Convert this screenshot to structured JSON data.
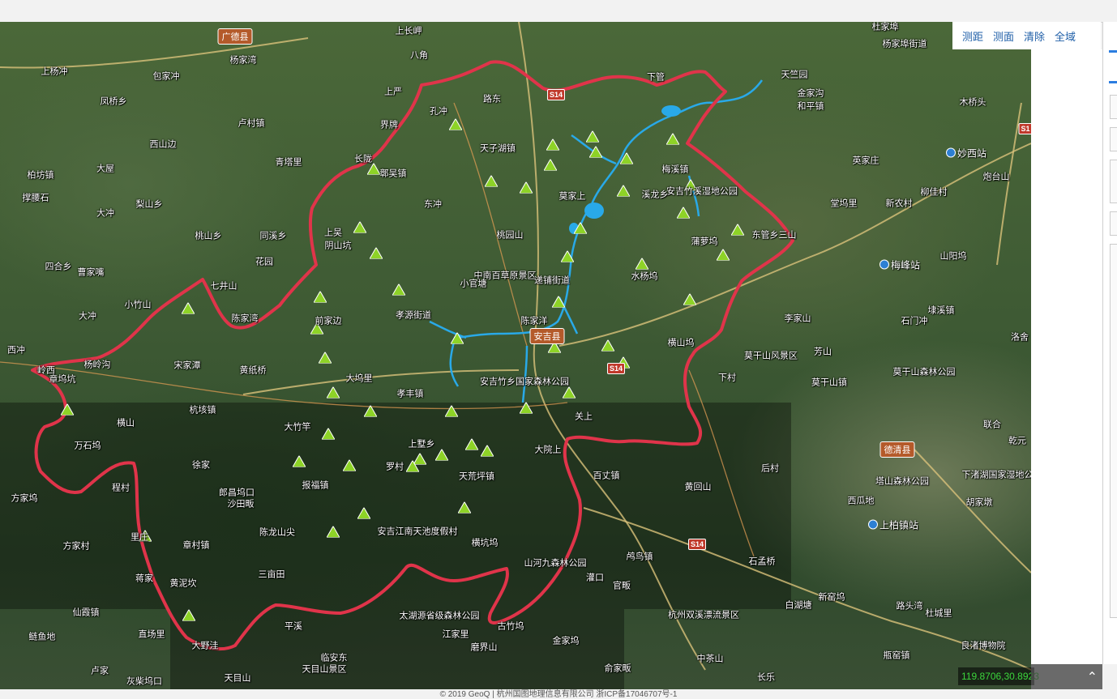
{
  "toolbar": {
    "measure_distance": "测距",
    "measure_area": "测面",
    "clear": "清除",
    "full_extent": "全域"
  },
  "coordinate_readout": "119.8706,30.8923",
  "copyright": "© 2019 GeoQ | 杭州国图地理信息有限公司 浙ICP备17046707号-1",
  "colors": {
    "boundary": "#e0344a",
    "reservoir": "#29a9e8",
    "marker": "#8ed327"
  },
  "counties": [
    "广德县",
    "安吉县",
    "德清县"
  ],
  "highway_shields": [
    "S14",
    "S14",
    "S14",
    "S1"
  ],
  "stations": [
    "妙西站",
    "梅峰站",
    "上柏镇站"
  ],
  "places": [
    "上长岬",
    "八角",
    "上杨冲",
    "包家冲",
    "杨家湾",
    "凤桥乡",
    "卢村镇",
    "西山边",
    "青塔里",
    "柏坊镇",
    "大屋",
    "梨山乡",
    "撑腰石",
    "大冲",
    "桃山乡",
    "同溪乡",
    "花园",
    "四合乡",
    "曹家嘴",
    "大冲",
    "小竹山",
    "七井山",
    "陈家湾",
    "西冲",
    "岭西",
    "章坞坑",
    "杨岭沟",
    "宋家潭",
    "黄纸桥",
    "前家边",
    "大坞里",
    "孝丰镇",
    "杭垓镇",
    "横山",
    "万石坞",
    "徐家",
    "程村",
    "方家坞",
    "方家村",
    "大竹竿",
    "郎昌坞口",
    "沙田畈",
    "报福镇",
    "陈龙山尖",
    "章村镇",
    "里庄",
    "蒋家",
    "黄泥坎",
    "三亩田",
    "仙霞镇",
    "鲢鱼地",
    "直场里",
    "大野洼",
    "卢家",
    "平溪",
    "临安东",
    "天目山景区",
    "天目山",
    "灰柴坞口",
    "上墅乡",
    "罗村",
    "天荒坪镇",
    "安吉江南天池度假村",
    "横坑坞",
    "山河九森林公园",
    "灌口",
    "官畈",
    "太湖源省级森林公园",
    "江家里",
    "磨界山",
    "金家坞",
    "俞家畈",
    "杭州双溪漂流景区",
    "中茶山",
    "长乐",
    "白湖塘",
    "新窑坞",
    "路头湾",
    "杜城里",
    "瓶窑镇",
    "良渚博物院",
    "西瓜地",
    "胡家墩",
    "塔山森林公园",
    "下渚湖国家湿地公园",
    "乾元",
    "联合",
    "洛舍",
    "石门冲",
    "埭溪镇",
    "英家庄",
    "新农村",
    "柳佳村",
    "炮台山",
    "堂坞里",
    "山阳坞",
    "莫干山森林公园",
    "莫干山镇",
    "莫干山风景区",
    "李家山",
    "芳山",
    "下村",
    "横山坞",
    "水杨坞",
    "蒲萝坞",
    "东管乡三山",
    "梅溪镇",
    "安吉竹溪湿地公园",
    "溪龙乡",
    "天子湖镇",
    "路东",
    "孔冲",
    "界牌",
    "长陇",
    "鄣吴镇",
    "上吴",
    "阴山坑",
    "东冲",
    "桃园山",
    "中南百草原景区",
    "小官塘",
    "孝源街道",
    "陈家洋",
    "安吉竹乡国家森林公园",
    "关上",
    "大院上",
    "百丈镇",
    "黄回山",
    "后村",
    "鸬鸟镇",
    "石孟桥",
    "下管",
    "天竺园",
    "金家沟",
    "和平镇",
    "杨家埠街道",
    "杜家埠",
    "木桥头",
    "莫家上",
    "递铺街道",
    "上严",
    "古竹坞"
  ]
}
